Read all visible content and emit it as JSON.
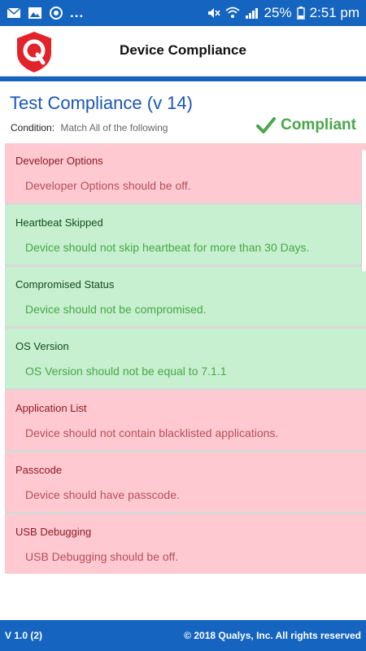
{
  "status_bar": {
    "left_icons": [
      "mail-icon",
      "image-icon",
      "sync-icon"
    ],
    "dots": "...",
    "battery": "25%",
    "time": "2:51 pm",
    "right_icons": [
      "mute-icon",
      "wifi-icon",
      "signal-icon",
      "battery-icon"
    ]
  },
  "header": {
    "title": "Device Compliance",
    "logo": "qualys-shield-logo",
    "logo_color": "#e2232a"
  },
  "policy": {
    "title": "Test Compliance (v 14)",
    "condition_label": "Condition:",
    "condition_value": "Match All of the following",
    "status": "Compliant",
    "status_color": "#4aa64a"
  },
  "items": [
    {
      "title": "Developer Options",
      "description": "Developer Options should be off.",
      "state": "fail"
    },
    {
      "title": "Heartbeat Skipped",
      "description": "Device should not skip heartbeat for more than 30 Days.",
      "state": "pass"
    },
    {
      "title": "Compromised Status",
      "description": "Device should not be compromised.",
      "state": "pass"
    },
    {
      "title": "OS Version",
      "description": "OS Version should not be equal to 7.1.1",
      "state": "pass"
    },
    {
      "title": "Application List",
      "description": "Device should not contain blacklisted applications.",
      "state": "fail"
    },
    {
      "title": "Passcode",
      "description": "Device should have passcode.",
      "state": "fail"
    },
    {
      "title": "USB Debugging",
      "description": "USB Debugging should be off.",
      "state": "fail"
    }
  ],
  "colors": {
    "brand_blue": "#1565c0",
    "fail_bg": "#ffc9d1",
    "pass_bg": "#c6f0cf"
  },
  "footer": {
    "version": "V 1.0 (2)",
    "copyright": "© 2018 Qualys, Inc. All rights reserved"
  }
}
